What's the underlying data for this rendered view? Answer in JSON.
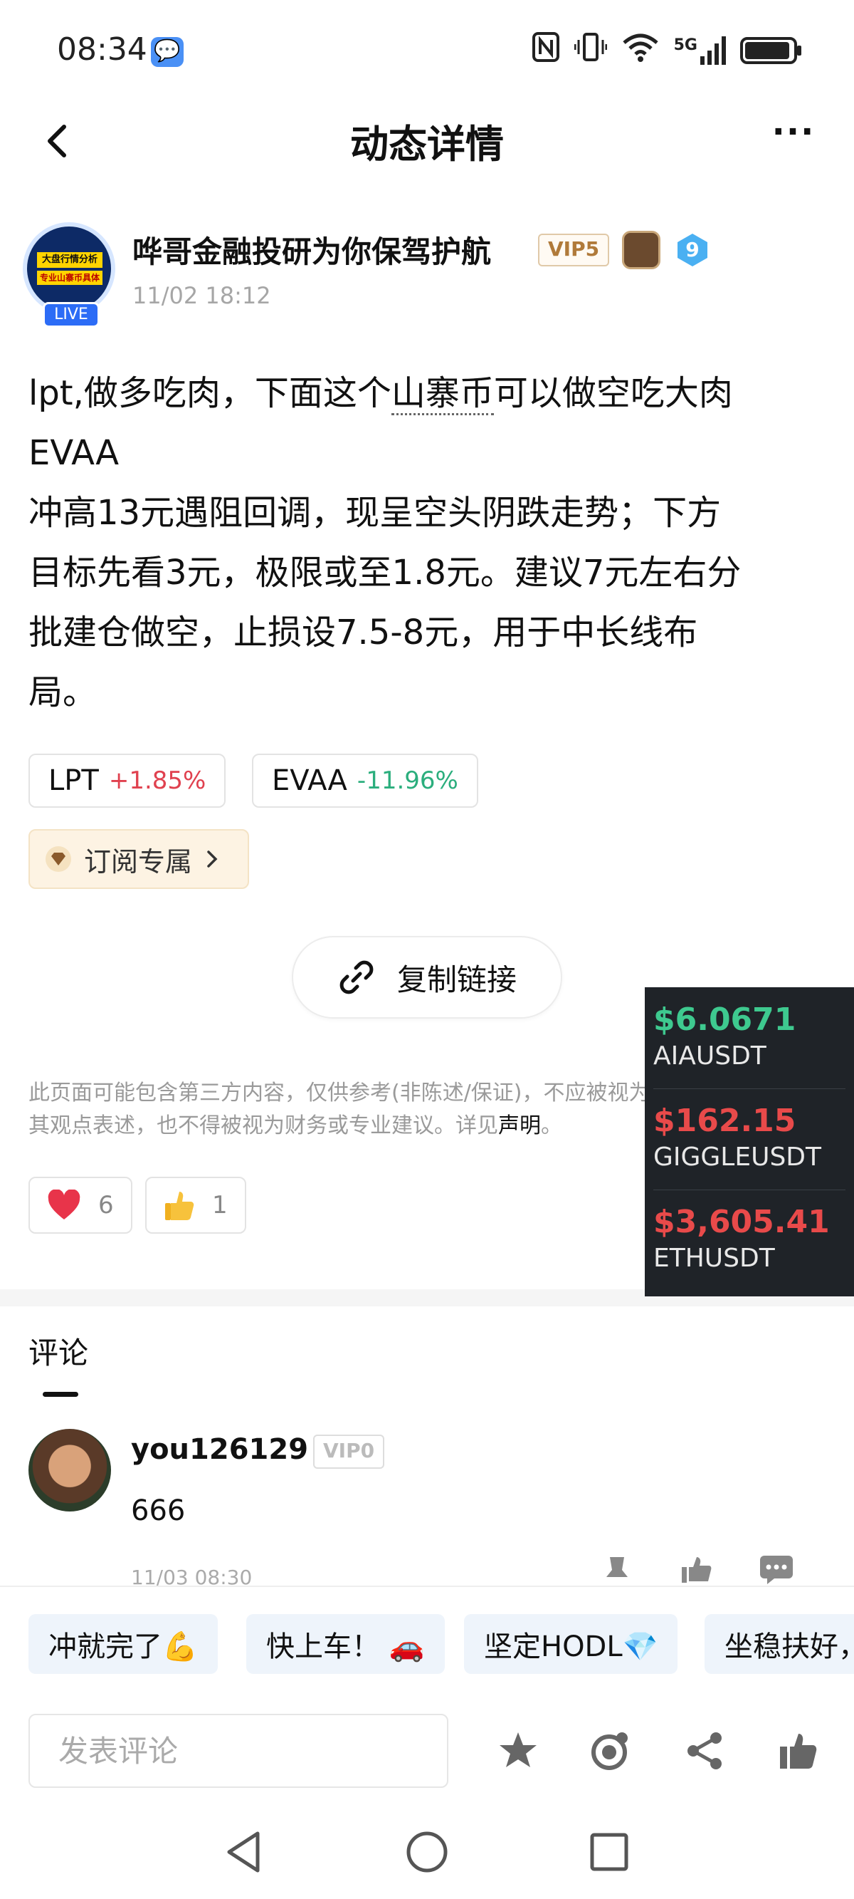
{
  "status_bar": {
    "time": "08:34",
    "network": "5G",
    "icons": [
      "chat-bubble-icon",
      "nfc-icon",
      "vibrate-icon",
      "wifi-icon",
      "signal-icon",
      "battery-charging-icon"
    ]
  },
  "header": {
    "title": "动态详情",
    "more": "···"
  },
  "author": {
    "avatar_lines": [
      "大盘行情分析",
      "专业山寨币具体"
    ],
    "live_label": "LIVE",
    "name": "哗哥金融投研为你保驾护航",
    "vip": "VIP5",
    "level": "9",
    "time": "11/02 18:12"
  },
  "post": {
    "line1_a": "lpt,做多吃肉，下面这个",
    "line1_u": "山寨币",
    "line1_b": "可以做空吃大肉",
    "line2": "EVAA",
    "line3": "冲高13元遇阻回调，现呈空头阴跌走势；下方",
    "line4": "目标先看3元，极限或至1.8元。建议7元左右分",
    "line5": "批建仓做空，止损设7.5-8元，用于中长线布",
    "line6": "局。"
  },
  "tokens": [
    {
      "symbol": "LPT",
      "change": "+1.85%"
    },
    {
      "symbol": "EVAA",
      "change": "-11.96%"
    }
  ],
  "subscribe_label": "订阅专属",
  "copy_link_label": "复制链接",
  "disclaimer": {
    "line1": "此页面可能包含第三方内容，仅供参考(非陈述/保证)，不应被视为Gate认可",
    "line2": "其观点表述，也不得被视为财务或专业建议。详见",
    "link": "声明",
    "end": "。"
  },
  "reactions": {
    "likes": "6",
    "thumbs": "1"
  },
  "ticker": [
    {
      "price": "$6.0671",
      "symbol": "AIAUSDT",
      "color": "#3ec98f"
    },
    {
      "price": "$162.15",
      "symbol": "GIGGLEUSDT",
      "color": "#e84a4a"
    },
    {
      "price": "$3,605.41",
      "symbol": "ETHUSDT",
      "color": "#e84a4a"
    }
  ],
  "comments": {
    "title": "评论",
    "items": [
      {
        "user": "you126129",
        "vip": "VIP0",
        "text": "666",
        "time": "11/03 08:30"
      }
    ]
  },
  "quick_replies": [
    "冲就完了💪",
    "快上车！ 🚗",
    "坚定HODL💎",
    "坐稳扶好，"
  ],
  "comment_input": {
    "placeholder": "发表评论"
  },
  "colors": {
    "up": "#e0414f",
    "down": "#2bae7d",
    "accent_blue": "#2c6cf6"
  }
}
